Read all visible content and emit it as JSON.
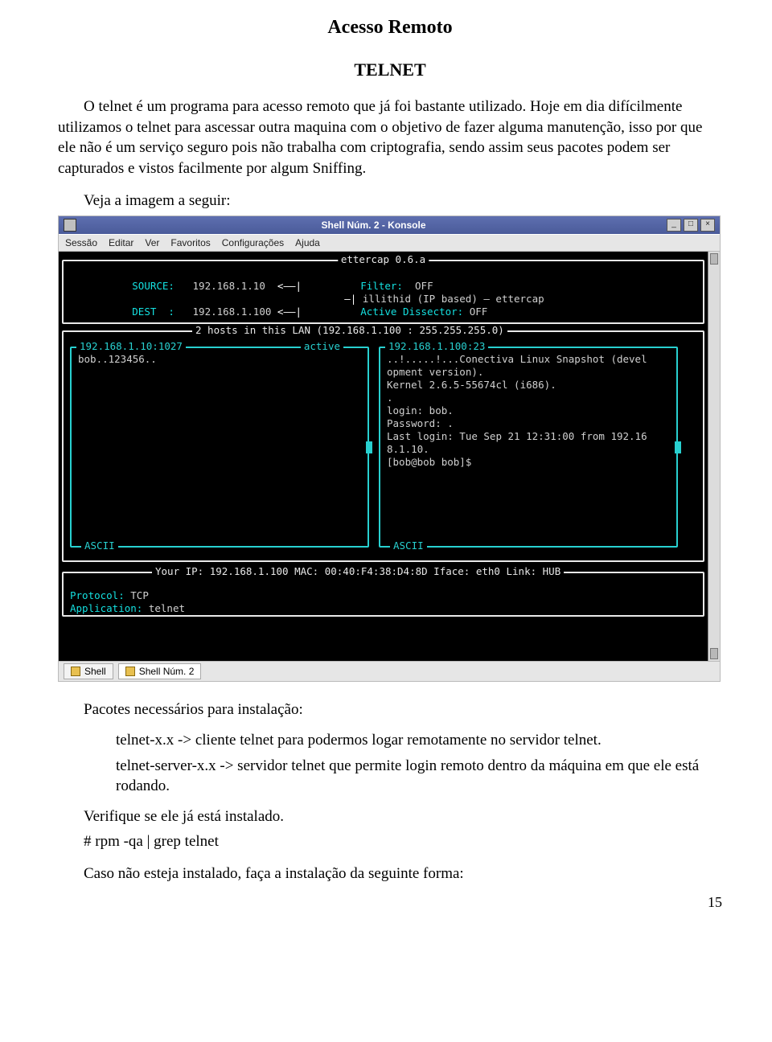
{
  "doc": {
    "title_main": "Acesso Remoto",
    "title_sub": "TELNET",
    "para1": "O telnet é um programa para acesso remoto que já foi bastante utilizado. Hoje em dia difícilmente  utilizamos o telnet para ascessar outra maquina com o objetivo de fazer alguma manutenção, isso por que ele não é um serviço seguro pois não trabalha com criptografia, sendo assim seus pacotes podem ser capturados e vistos facilmente por algum Sniffing.",
    "para2": "Veja a imagem a seguir:",
    "pkg_heading": "Pacotes necessários para instalação:",
    "pkg_line1": "telnet-x.x ->  cliente telnet para podermos logar remotamente no servidor telnet.",
    "pkg_line2": "telnet-server-x.x ->  servidor telnet que permite login remoto dentro da máquina em que ele está rodando.",
    "verify_heading": "Verifique se ele já está instalado.",
    "verify_cmd": "# rpm -qa | grep telnet",
    "install_line": "Caso não esteja instalado, faça a instalação da seguinte forma:",
    "page_num": "15"
  },
  "shot": {
    "title": "Shell Núm. 2 - Konsole",
    "menus": [
      "Sessão",
      "Editar",
      "Ver",
      "Favoritos",
      "Configurações",
      "Ajuda"
    ],
    "winbtns": [
      "_",
      "□",
      "×"
    ],
    "tabs": [
      "Shell",
      "Shell Núm. 2"
    ],
    "ettercap": {
      "banner": "ettercap 0.6.a",
      "source_lbl": "SOURCE:",
      "source_ip": "192.168.1.10",
      "dest_lbl": "DEST  :",
      "dest_ip": "192.168.1.100",
      "arrow": "<",
      "pipe": "|",
      "end": "—|",
      "filter_lbl": "Filter:",
      "filter_val": "OFF",
      "illithid": "illithid (IP based) — ettercap",
      "dissector_lbl": "Active Dissector:",
      "dissector_val": "OFF",
      "hosts_line": "2 hosts in this LAN (192.168.1.100 : 255.255.255.0)",
      "left_box_legend": "192.168.1.10:1027",
      "left_box_status": "active",
      "left_box_body": "bob..123456..",
      "right_box_legend": "192.168.1.100:23",
      "right_box_body": "..!.....!...Conectiva Linux Snapshot (devel\nopment version).\nKernel 2.6.5-55674cl (i686).\n.\nlogin: bob.\nPassword: .\nLast login: Tue Sep 21 12:31:00 from 192.16\n8.1.10.\n[bob@bob bob]$",
      "ascii_foot": "ASCII",
      "yourip_line": "Your IP: 192.168.1.100 MAC: 00:40:F4:38:D4:8D Iface: eth0 Link: HUB",
      "proto_lbl": "Protocol:",
      "proto_val": "TCP",
      "app_lbl": "Application:",
      "app_val": "telnet"
    }
  }
}
